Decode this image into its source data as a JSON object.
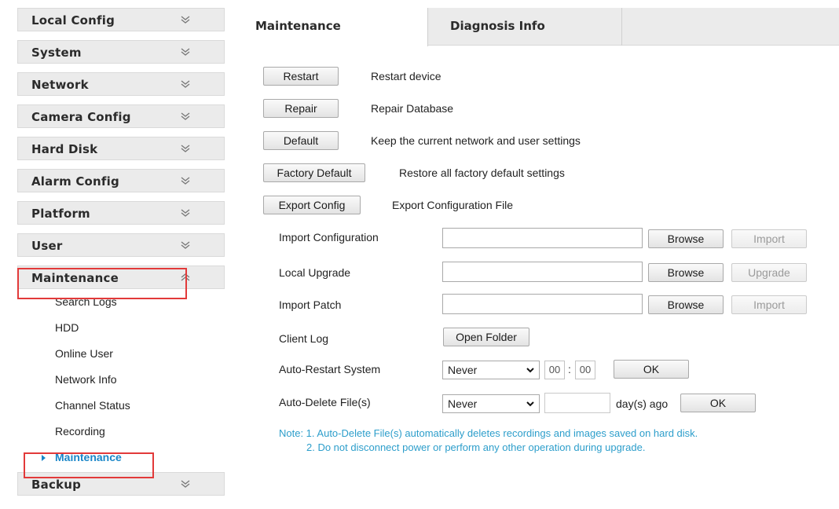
{
  "sidebar": {
    "items": [
      {
        "label": "Local Config"
      },
      {
        "label": "System"
      },
      {
        "label": "Network"
      },
      {
        "label": "Camera Config"
      },
      {
        "label": "Hard Disk"
      },
      {
        "label": "Alarm Config"
      },
      {
        "label": "Platform"
      },
      {
        "label": "User"
      },
      {
        "label": "Maintenance"
      },
      {
        "label": "Backup"
      }
    ],
    "submenu": [
      {
        "label": "Search Logs"
      },
      {
        "label": "HDD"
      },
      {
        "label": "Online User"
      },
      {
        "label": "Network Info"
      },
      {
        "label": "Channel Status"
      },
      {
        "label": "Recording"
      },
      {
        "label": "Maintenance"
      }
    ]
  },
  "tabs": [
    {
      "label": "Maintenance"
    },
    {
      "label": "Diagnosis Info"
    }
  ],
  "actions": [
    {
      "button": "Restart",
      "desc": "Restart device"
    },
    {
      "button": "Repair",
      "desc": "Repair Database"
    },
    {
      "button": "Default",
      "desc": "Keep the current network and user settings"
    },
    {
      "button": "Factory Default",
      "desc": "Restore all factory default settings"
    },
    {
      "button": "Export Config",
      "desc": "Export Configuration File"
    }
  ],
  "form": {
    "import_config": {
      "label": "Import Configuration",
      "value": "",
      "browse": "Browse",
      "action": "Import"
    },
    "local_upgrade": {
      "label": "Local Upgrade",
      "value": "",
      "browse": "Browse",
      "action": "Upgrade"
    },
    "import_patch": {
      "label": "Import Patch",
      "value": "",
      "browse": "Browse",
      "action": "Import"
    },
    "client_log": {
      "label": "Client Log",
      "button": "Open Folder"
    },
    "auto_restart": {
      "label": "Auto-Restart System",
      "select": "Never",
      "hour": "00",
      "sep": ":",
      "minute": "00",
      "ok": "OK"
    },
    "auto_delete": {
      "label": "Auto-Delete File(s)",
      "select": "Never",
      "days": "",
      "suffix": "day(s) ago",
      "ok": "OK"
    }
  },
  "note": {
    "line1": "Note: 1. Auto-Delete File(s) automatically deletes recordings and images saved on hard disk.",
    "line2": "2. Do not disconnect power or perform any other operation during upgrade."
  },
  "colors": {
    "accent": "#1a86c8",
    "highlight": "#e23a3a",
    "note": "#2d9ecb"
  }
}
